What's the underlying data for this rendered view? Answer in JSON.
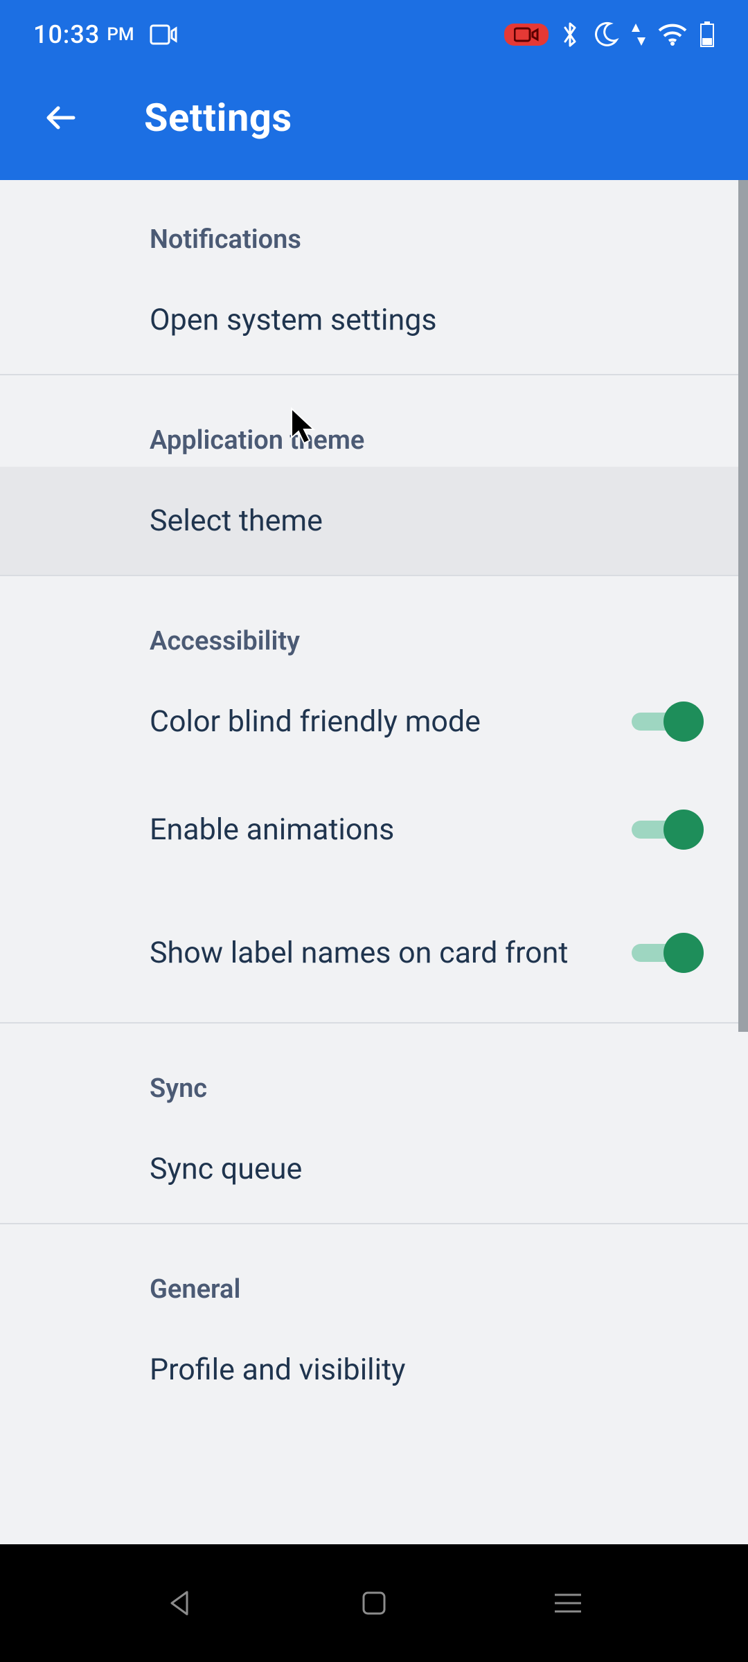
{
  "status": {
    "time": "10:33",
    "ampm": "PM"
  },
  "appbar": {
    "title": "Settings"
  },
  "sections": {
    "notifications": {
      "header": "Notifications",
      "open_system": "Open system settings"
    },
    "theme": {
      "header": "Application theme",
      "select_theme": "Select theme"
    },
    "accessibility": {
      "header": "Accessibility",
      "color_blind": "Color blind friendly mode",
      "animations": "Enable animations",
      "label_names": "Show label names on card front",
      "color_blind_on": true,
      "animations_on": true,
      "label_names_on": true
    },
    "sync": {
      "header": "Sync",
      "sync_queue": "Sync queue"
    },
    "general": {
      "header": "General",
      "profile": "Profile and visibility"
    }
  },
  "colors": {
    "primary": "#1c6fe3",
    "switch_on": "#1e8e5a",
    "section_header": "#4b5a74",
    "row_text": "#1f344e",
    "bg": "#f1f2f4"
  }
}
